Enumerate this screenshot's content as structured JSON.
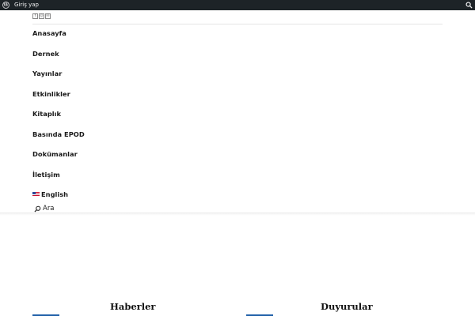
{
  "admin_bar": {
    "logo_icon": "wordpress-logo-icon",
    "login_label": "Giriş yap",
    "search_icon": "search-icon"
  },
  "social_icons": [
    "facebook-icon",
    "instagram-icon",
    "email-icon"
  ],
  "nav": {
    "items": [
      {
        "label": "Anasayfa"
      },
      {
        "label": "Dernek"
      },
      {
        "label": "Yayınlar"
      },
      {
        "label": "Etkinlikler"
      },
      {
        "label": "Kitaplık"
      },
      {
        "label": "Basında EPOD"
      },
      {
        "label": "Dokümanlar"
      },
      {
        "label": "İletişim"
      },
      {
        "label": "English",
        "icon": "us-flag-icon"
      }
    ],
    "search_label": "Ara"
  },
  "sections": {
    "news_title": "Haberler",
    "announcements_title": "Duyurular"
  },
  "colors": {
    "admin_bar_bg": "#1d2327",
    "accent_blue": "#1f5fa8"
  }
}
